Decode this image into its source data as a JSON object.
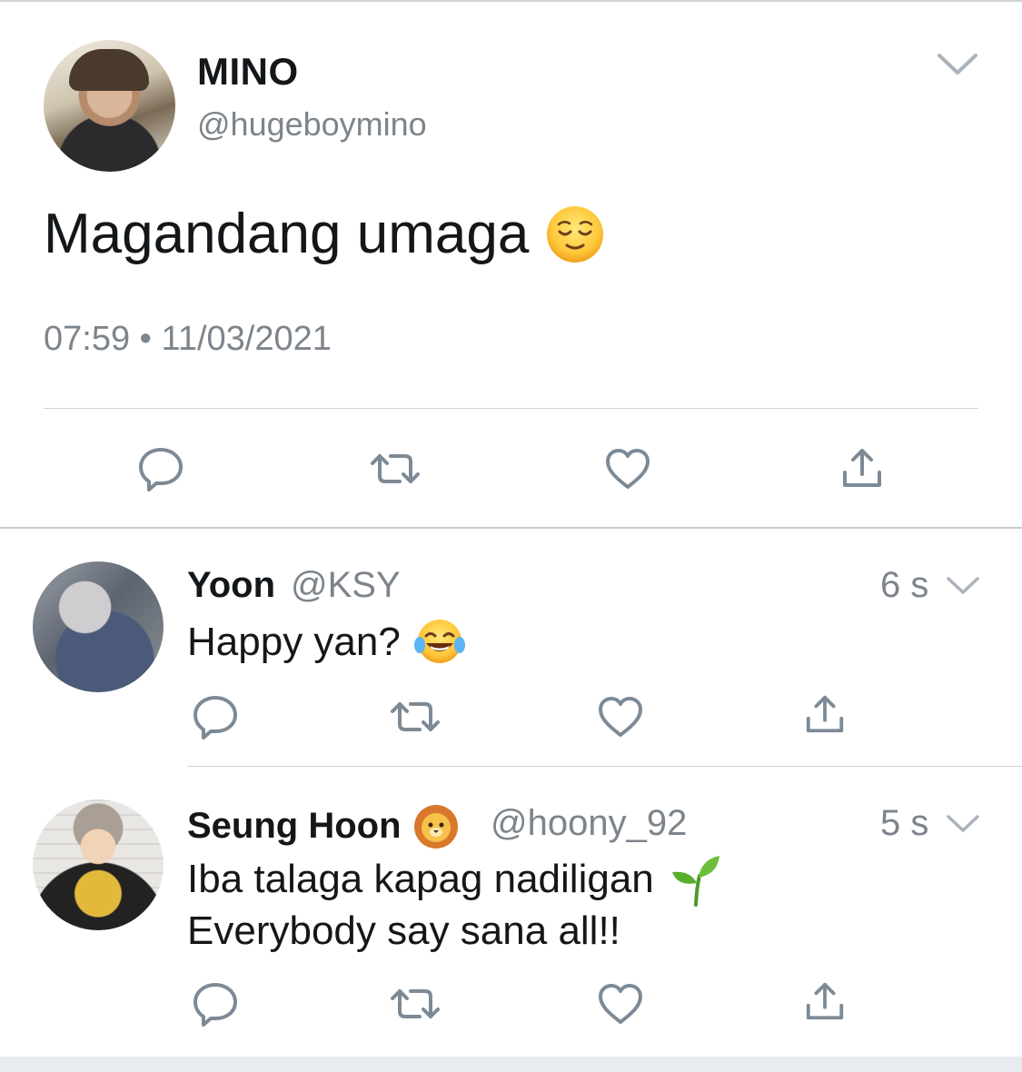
{
  "tweet": {
    "author_name": "MINO",
    "author_handle": "@hugeboymino",
    "text": "Magandang umaga",
    "text_emoji": "relieved-face",
    "timestamp": "07:59 • 11/03/2021",
    "actions": [
      "reply-icon",
      "retweet-icon",
      "like-icon",
      "share-icon"
    ]
  },
  "replies": [
    {
      "name": "Yoon",
      "handle": "@KSY",
      "time": "6 s",
      "text": "Happy yan?",
      "text_emoji": "face-with-tears-of-joy"
    },
    {
      "name": "Seung Hoon",
      "name_emoji": "lion-face",
      "handle": "@hoony_92",
      "time": "5 s",
      "text_line1": "Iba talaga kapag nadiligan",
      "text_line1_emoji": "seedling",
      "text_line2": "Everybody say sana all!!"
    }
  ],
  "colors": {
    "text": "#14171a",
    "secondary": "#7d848b",
    "icon": "#7d8a96",
    "divider": "#cfd4d9"
  }
}
